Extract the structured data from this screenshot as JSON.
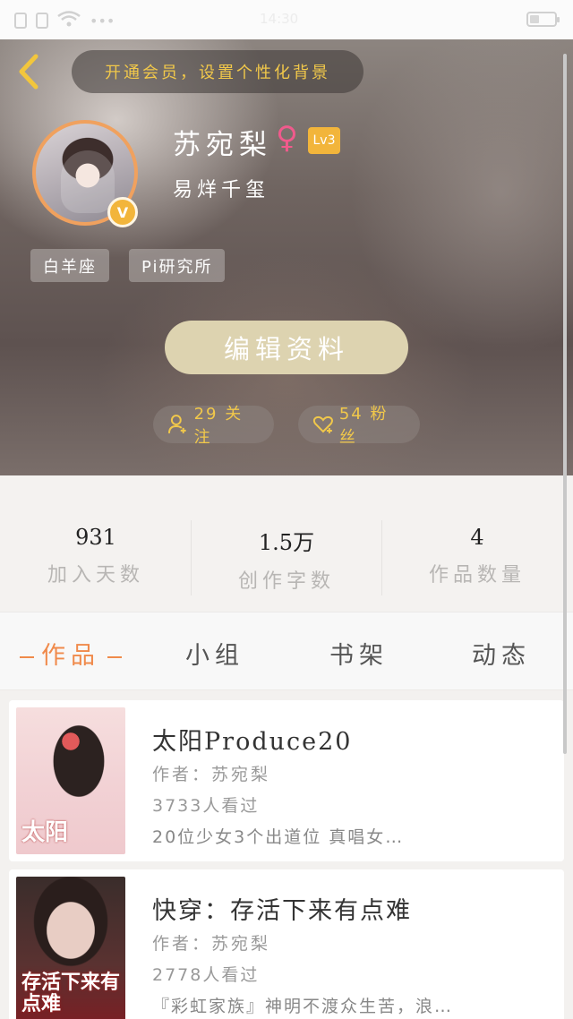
{
  "status_bar": {
    "time": "14:30"
  },
  "header": {
    "vip_banner": "开通会员，设置个性化背景",
    "username": "苏宛梨",
    "gender_symbol": "♀",
    "level": "Lv3",
    "signature": "易烊千玺",
    "tags": [
      "白羊座",
      "Pi研究所"
    ],
    "edit_button": "编辑资料",
    "following_label": "29 关注",
    "fans_label": "54 粉丝",
    "badge_letter": "V",
    "colors": {
      "accent": "#f2b53b",
      "gender": "#f05a8c",
      "highlight": "#f1c84a"
    }
  },
  "stats": [
    {
      "value": "931",
      "label": "加入天数"
    },
    {
      "value": "1.5万",
      "label": "创作字数"
    },
    {
      "value": "4",
      "label": "作品数量"
    }
  ],
  "tabs": [
    {
      "label": "作品",
      "active": true
    },
    {
      "label": "小组",
      "active": false
    },
    {
      "label": "书架",
      "active": false
    },
    {
      "label": "动态",
      "active": false
    }
  ],
  "works": [
    {
      "title": "太阳Produce20",
      "author": "作者：苏宛梨",
      "views": "3733人看过",
      "description": "20位少女3个出道位 真唱女…",
      "cover_text": "太阳"
    },
    {
      "title": "快穿：存活下来有点难",
      "author": "作者：苏宛梨",
      "views": "2778人看过",
      "description": "『彩虹家族』神明不渡众生苦，浪…",
      "cover_text": "存活下来有点难"
    }
  ]
}
